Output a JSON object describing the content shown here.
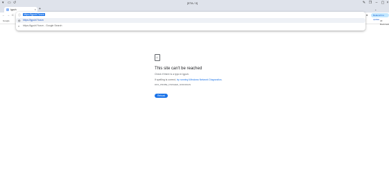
{
  "window": {
    "title": "[ETA / 0]",
    "left_icons": [
      "app-menu-icon",
      "tab-search-icon",
      "history-icon"
    ],
    "controls": [
      "minimize",
      "maximize",
      "close"
    ]
  },
  "tab": {
    "title": "lgpuh",
    "close": "×",
    "new_tab": "+"
  },
  "toolbar": {
    "back": "←",
    "forward": "→",
    "reload": "C",
    "relaunch_label": "Relaunch to update"
  },
  "omnibox": {
    "input_value": "https://lgpuh/?ivzzn",
    "suggestions": [
      {
        "text": "https://lgpuh/?ivzzn",
        "icon": "globe-icon",
        "selected": true
      },
      {
        "text": "https://lgpuh/?ivzzn - Google Search",
        "icon": "search-icon",
        "selected": false
      }
    ]
  },
  "bookmarks": {
    "left_label": "Google",
    "right_label": "All Bookmarks"
  },
  "error_page": {
    "title": "This site can't be reached",
    "line1": "Check if there is a typo in lgpuh.",
    "line2_prefix": "If spelling is correct, ",
    "line2_link": "try running Windows Network Diagnostics",
    "line2_suffix": ".",
    "code": "DNS_PROBE_FINISHED_NXDOMAIN",
    "reload_label": "Reload"
  },
  "colors": {
    "accent": "#1a73e8",
    "titlebar": "#dfe3eb"
  }
}
